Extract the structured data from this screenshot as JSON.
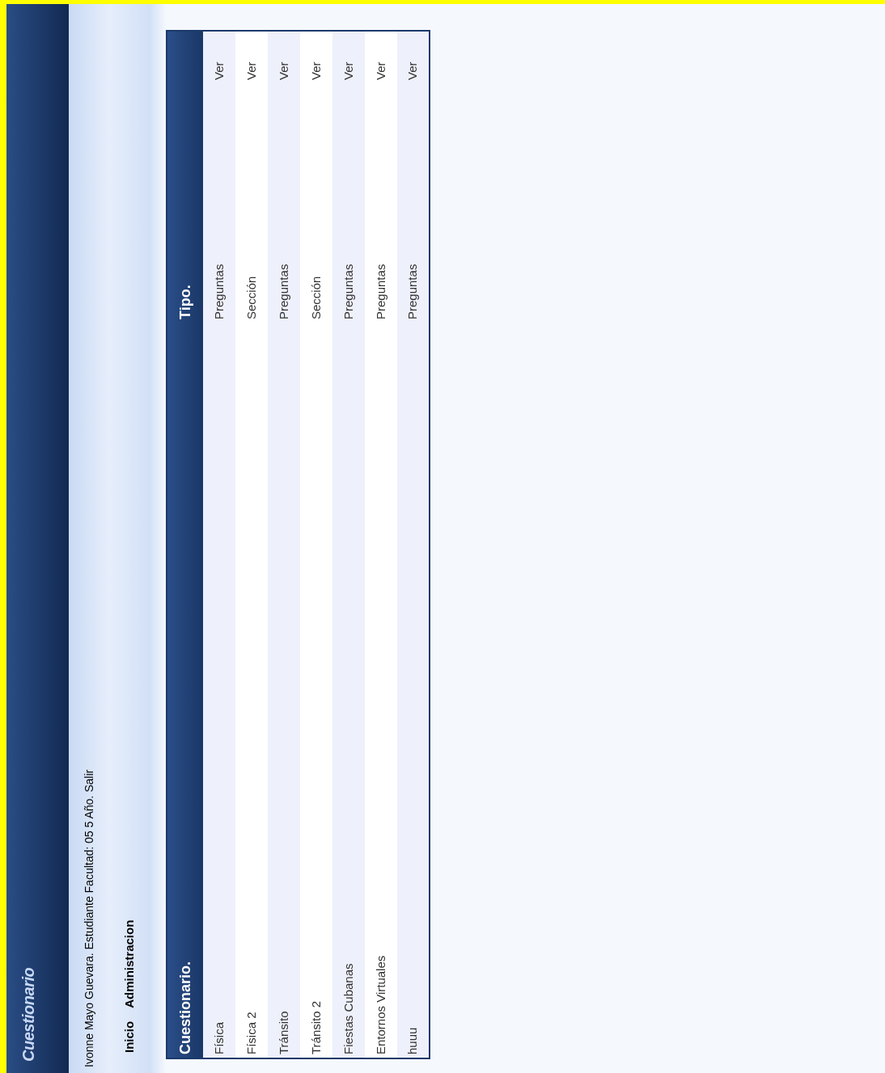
{
  "header": {
    "title": "Cuestionario"
  },
  "user_bar": {
    "text": "Ivonne Mayo Guevara. Estudiante Facultad: 05 5 Año.",
    "link": "Salir"
  },
  "menu": [
    {
      "label": "Inicio"
    },
    {
      "label": "Administracion"
    }
  ],
  "table": {
    "columns": [
      "Cuestionario.",
      "Tipo."
    ],
    "rows": [
      {
        "name": "Física",
        "type": "Preguntas",
        "action": "Ver"
      },
      {
        "name": "Física 2",
        "type": "Sección",
        "action": "Ver"
      },
      {
        "name": "Tránsito",
        "type": "Preguntas",
        "action": "Ver"
      },
      {
        "name": "Tránsito 2",
        "type": "Sección",
        "action": "Ver"
      },
      {
        "name": "Fiestas Cubanas",
        "type": "Preguntas",
        "action": "Ver"
      },
      {
        "name": "Entornos Virtuales",
        "type": "Preguntas",
        "action": "Ver"
      },
      {
        "name": "huuu",
        "type": "Preguntas",
        "action": "Ver"
      }
    ]
  }
}
